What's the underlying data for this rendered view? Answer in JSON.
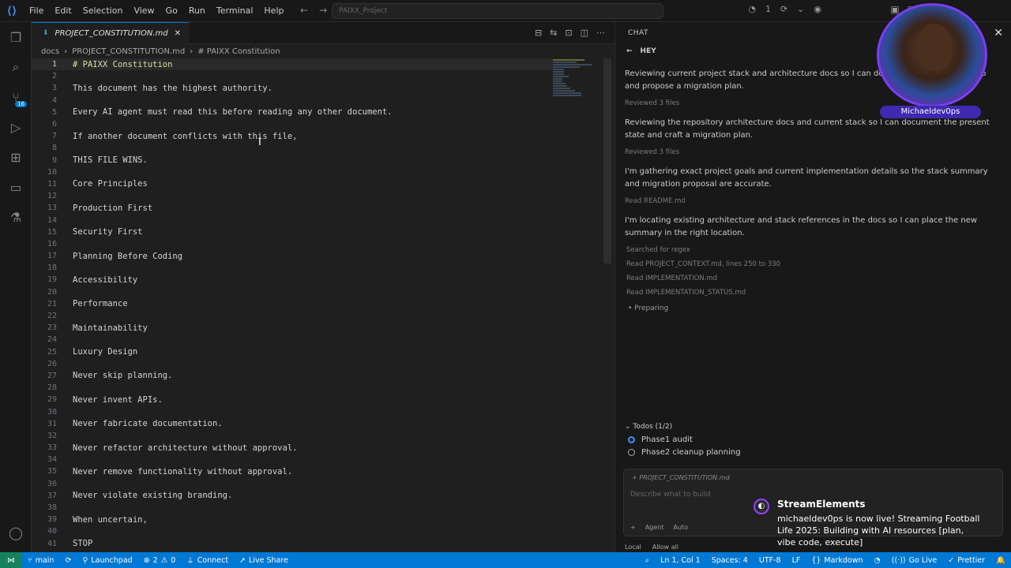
{
  "menu": [
    "File",
    "Edit",
    "Selection",
    "View",
    "Go",
    "Run",
    "Terminal",
    "Help"
  ],
  "title_search": "PAIXX_Project",
  "title_bar_count": "1",
  "editor": {
    "tab_label": "PROJECT_CONSTITUTION.md",
    "breadcrumb": [
      "docs",
      "PROJECT_CONSTITUTION.md",
      "# PAIXX Constitution"
    ],
    "lines": [
      {
        "n": "1",
        "t": "# PAIXX Constitution"
      },
      {
        "n": "2",
        "t": ""
      },
      {
        "n": "3",
        "t": "This document has the highest authority."
      },
      {
        "n": "4",
        "t": ""
      },
      {
        "n": "5",
        "t": "Every AI agent must read this before reading any other document."
      },
      {
        "n": "6",
        "t": ""
      },
      {
        "n": "7",
        "t": "If another document conflicts with this file,"
      },
      {
        "n": "8",
        "t": ""
      },
      {
        "n": "9",
        "t": "THIS FILE WINS."
      },
      {
        "n": "10",
        "t": ""
      },
      {
        "n": "11",
        "t": "Core Principles"
      },
      {
        "n": "12",
        "t": ""
      },
      {
        "n": "13",
        "t": "Production First"
      },
      {
        "n": "14",
        "t": ""
      },
      {
        "n": "15",
        "t": "Security First"
      },
      {
        "n": "16",
        "t": ""
      },
      {
        "n": "17",
        "t": "Planning Before Coding"
      },
      {
        "n": "18",
        "t": ""
      },
      {
        "n": "19",
        "t": "Accessibility"
      },
      {
        "n": "20",
        "t": ""
      },
      {
        "n": "21",
        "t": "Performance"
      },
      {
        "n": "22",
        "t": ""
      },
      {
        "n": "23",
        "t": "Maintainability"
      },
      {
        "n": "24",
        "t": ""
      },
      {
        "n": "25",
        "t": "Luxury Design"
      },
      {
        "n": "26",
        "t": ""
      },
      {
        "n": "27",
        "t": "Never skip planning."
      },
      {
        "n": "28",
        "t": ""
      },
      {
        "n": "29",
        "t": "Never invent APIs."
      },
      {
        "n": "30",
        "t": ""
      },
      {
        "n": "31",
        "t": "Never fabricate documentation."
      },
      {
        "n": "32",
        "t": ""
      },
      {
        "n": "33",
        "t": "Never refactor architecture without approval."
      },
      {
        "n": "34",
        "t": ""
      },
      {
        "n": "35",
        "t": "Never remove functionality without approval."
      },
      {
        "n": "36",
        "t": ""
      },
      {
        "n": "37",
        "t": "Never violate existing branding."
      },
      {
        "n": "38",
        "t": ""
      },
      {
        "n": "39",
        "t": "When uncertain,"
      },
      {
        "n": "40",
        "t": ""
      },
      {
        "n": "41",
        "t": "STOP"
      }
    ]
  },
  "chat": {
    "header": "CHAT",
    "session": "HEY",
    "messages": [
      {
        "text": "Reviewing current project stack and architecture docs so I can document the present setup and propose a migration plan.",
        "meta": "Reviewed 3 files"
      },
      {
        "text": "Reviewing the repository architecture docs and current stack so I can document the present state and craft a migration plan.",
        "meta": "Reviewed 3 files"
      },
      {
        "text": "I'm gathering exact project goals and current implementation details so the stack summary and migration proposal are accurate.",
        "meta": "Read README.md"
      },
      {
        "text": "I'm locating existing architecture and stack references in the docs so I can place the new summary in the right location.",
        "meta": ""
      }
    ],
    "tools": [
      "Searched for regex",
      "Read PROJECT_CONTEXT.md, lines 250 to 330",
      "Read IMPLEMENTATION.md",
      "Read IMPLEMENTATION_STATUS.md"
    ],
    "preparing": "Preparing",
    "todos_header": "Todos (1/2)",
    "todos": [
      "Phase1 audit",
      "Phase2 cleanup planning"
    ],
    "context_file": "PROJECT_CONSTITUTION.md",
    "input_placeholder": "Describe what to build",
    "mode_agent": "Agent",
    "mode_auto": "Auto",
    "foot_local": "Local",
    "foot_allow": "Allow all"
  },
  "webcam": {
    "name": "Michaeldev0ps"
  },
  "notification": {
    "title": "StreamElements",
    "text": "michaeldev0ps is now live! Streaming Football Life 2025: Building with AI resources [plan, vibe code, execute]"
  },
  "statusbar": {
    "branch": "main",
    "launchpad": "Launchpad",
    "errors": "2",
    "warnings": "0",
    "connect": "Connect",
    "live_share": "Live Share",
    "position": "Ln 1, Col 1",
    "spaces": "Spaces: 4",
    "encoding": "UTF-8",
    "eol": "LF",
    "language": "Markdown",
    "go_live": "Go Live",
    "prettier": "Prettier"
  },
  "colors": {
    "statusbar": "#0078d4",
    "accent": "#3794ff",
    "webcam_ring": "#7a3ef0"
  }
}
